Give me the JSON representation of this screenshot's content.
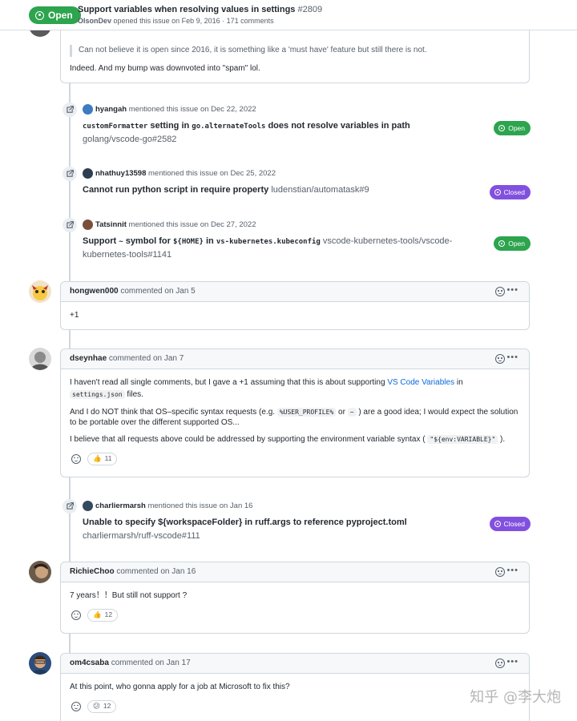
{
  "header": {
    "state": "Open",
    "title": "Support variables when resolving values in settings",
    "number": "#2809",
    "author": "OlsonDev",
    "meta": "opened this issue on Feb 9, 2016 · 171 comments"
  },
  "top_comment": {
    "quote": "Can not believe it is open since 2016, it is something like a 'must have' feature but still there is not.",
    "text": "Indeed. And my bump was downvoted into \"spam\" lol."
  },
  "mentions": [
    {
      "user": "hyangah",
      "action": "mentioned this issue on Dec 22, 2022",
      "code1": "customFormatter",
      "t1": " setting in ",
      "code2": "go.alternateTools",
      "t2": " does not resolve variables in path",
      "repo": "golang/vscode-go#2582",
      "status": "Open"
    },
    {
      "user": "nhathuy13598",
      "action": "mentioned this issue on Dec 25, 2022",
      "title": "Cannot run python script in require property",
      "repo": "ludenstian/automatask#9",
      "status": "Closed"
    },
    {
      "user": "Tatsinnit",
      "action": "mentioned this issue on Dec 27, 2022",
      "t0": "Support ",
      "code1": "~",
      "t1": " symbol for ",
      "code2": "${HOME}",
      "t2": " in ",
      "code3": "vs-kubernetes.kubeconfig",
      "repo": "vscode-kubernetes-tools/vscode-kubernetes-tools#1141",
      "status": "Open"
    },
    {
      "user": "charliermarsh",
      "action": "mentioned this issue on Jan 16",
      "title": "Unable to specify ${workspaceFolder} in ruff.args to reference pyproject.toml",
      "repo": "charliermarsh/ruff-vscode#111",
      "status": "Closed"
    }
  ],
  "comments": [
    {
      "user": "hongwen000",
      "action": "commented on Jan 5",
      "body": "+1"
    },
    {
      "user": "dseynhae",
      "action": "commented on Jan 7",
      "p1a": "I haven't read all single comments, but I gave a +1 assuming that this is about supporting ",
      "p1link": "VS Code Variables",
      "p1b": " in",
      "p1code": "settings.json",
      "p1c": " files.",
      "p2a": "And I do NOT think that OS–specific syntax requests (e.g. ",
      "p2code1": "%USER_PROFILE%",
      "p2b": " or ",
      "p2code2": "~",
      "p2c": " ) are a good idea; I would expect the solution to be portable over the different supported OS...",
      "p3a": "I believe that all requests above could be addressed by supporting the environment variable syntax ( ",
      "p3code": "\"${env:VARIABLE}\"",
      "p3b": " ).",
      "reaction_emoji": "👍",
      "reaction_count": "11"
    },
    {
      "user": "RichieChoo",
      "action": "commented on Jan 16",
      "body": "7 years！！But still not support ?",
      "reaction_emoji": "👍",
      "reaction_count": "12"
    },
    {
      "user": "om4csaba",
      "action": "commented on Jan 17",
      "body": "At this point, who gonna apply for a job at Microsoft to fix this?",
      "reaction_emoji": "😕",
      "reaction_count": "12"
    }
  ],
  "kebab": "•••",
  "watermark": "知乎 @李大炮"
}
